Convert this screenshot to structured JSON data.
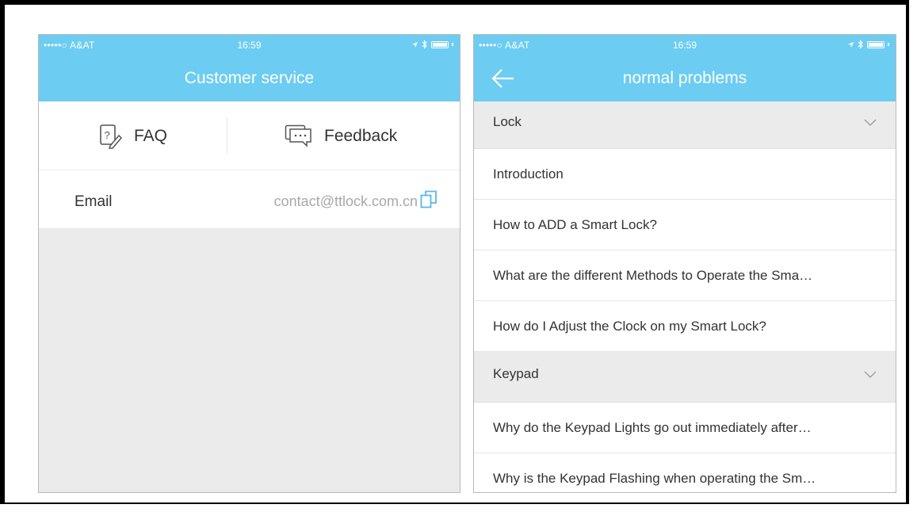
{
  "left_phone": {
    "status": {
      "carrier": "•••••○ A&AT",
      "time": "16:59"
    },
    "title": "Customer service",
    "tabs": [
      {
        "label": "FAQ",
        "icon": "faq-icon"
      },
      {
        "label": "Feedback",
        "icon": "chat-icon"
      }
    ],
    "email": {
      "label": "Email",
      "value": "contact@ttlock.com.cn",
      "icon": "copy-icon"
    }
  },
  "right_phone": {
    "status": {
      "carrier": "•••••○ A&AT",
      "time": "16:59"
    },
    "title": "normal problems",
    "sections": [
      {
        "label": "Lock",
        "items": [
          "Introduction",
          "How to ADD a Smart Lock?",
          "What are the different Methods to Operate the Sma…",
          "How do I Adjust the Clock on my Smart Lock?"
        ]
      },
      {
        "label": "Keypad",
        "items": [
          "Why do the Keypad Lights go out immediately after…",
          "Why is the Keypad Flashing when operating the Sm…"
        ]
      }
    ]
  },
  "colors": {
    "accent": "#6dccf2",
    "gray_bg": "#ebebeb",
    "copy_icon": "#5ab8ea"
  }
}
